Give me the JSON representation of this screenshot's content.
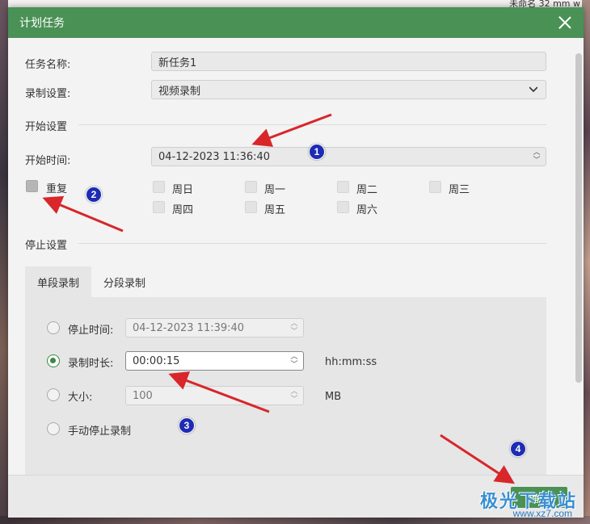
{
  "background": {
    "top_right_text": "未命名 32 mm w"
  },
  "dialog": {
    "title": "计划任务",
    "task_name_label": "任务名称:",
    "task_name_value": "新任务1",
    "record_settings_label": "录制设置:",
    "record_settings_value": "视频录制",
    "start_section": "开始设置",
    "start_time_label": "开始时间:",
    "start_time_value": "04-12-2023 11:36:40",
    "repeat_label": "重复",
    "weekdays": [
      "周日",
      "周一",
      "周二",
      "周三",
      "周四",
      "周五",
      "周六"
    ],
    "stop_section": "停止设置",
    "tabs": [
      "单段录制",
      "分段录制"
    ],
    "stop_time_label": "停止时间:",
    "stop_time_value": "04-12-2023 11:39:40",
    "duration_label": "录制时长:",
    "duration_value": "00:00:15",
    "duration_unit": "hh:mm:ss",
    "size_label": "大小:",
    "size_value": "100",
    "size_unit": "MB",
    "manual_stop_label": "手动停止录制",
    "ok_button": "确定"
  },
  "annotations": [
    "1",
    "2",
    "3",
    "4"
  ],
  "watermark": {
    "brand": "极光下载站",
    "url": "www.xz7.com"
  },
  "colors": {
    "titlebar": "#4a9155",
    "accent_radio": "#3a8a45",
    "marker": "#1d2bb5",
    "arrow": "#d8262b"
  }
}
